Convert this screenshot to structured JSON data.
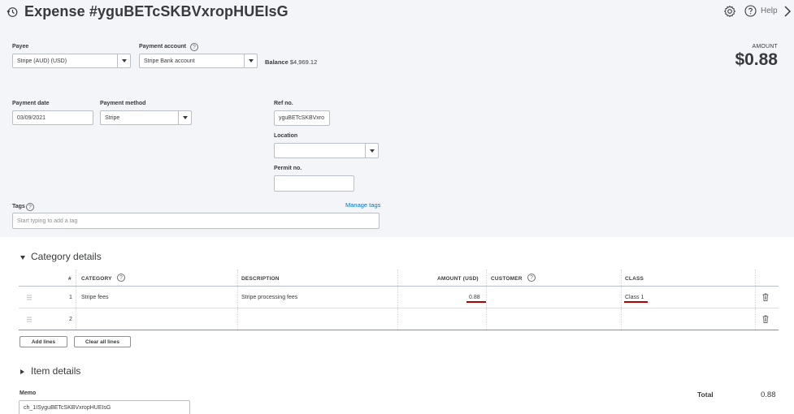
{
  "header": {
    "title": "Expense #yguBETcSKBVxropHUEIsG",
    "help_label": "Help",
    "icons": [
      "history-icon",
      "gear-icon",
      "help-icon",
      "chevron-right-icon"
    ]
  },
  "form": {
    "payee": {
      "label": "Payee",
      "value": "Stripe (AUD) (USD)"
    },
    "payment_account": {
      "label": "Payment account",
      "value": "Stripe Bank account"
    },
    "balance": {
      "label": "Balance",
      "value": "$4,969.12"
    },
    "amount": {
      "label": "AMOUNT",
      "value": "$0.88"
    },
    "payment_date": {
      "label": "Payment date",
      "value": "03/09/2021"
    },
    "payment_method": {
      "label": "Payment method",
      "value": "Stripe"
    },
    "ref_no": {
      "label": "Ref no.",
      "value": "yguBETcSKBVxro"
    },
    "location": {
      "label": "Location",
      "value": ""
    },
    "permit_no": {
      "label": "Permit no.",
      "value": ""
    },
    "tags": {
      "label": "Tags",
      "placeholder": "Start typing to add a tag",
      "manage_link": "Manage tags"
    }
  },
  "category_details": {
    "title": "Category details",
    "columns": {
      "num": "#",
      "category": "CATEGORY",
      "description": "DESCRIPTION",
      "amount": "AMOUNT (USD)",
      "customer": "CUSTOMER",
      "class": "CLASS"
    },
    "rows": [
      {
        "num": "1",
        "category": "Stripe fees",
        "description": "Stripe processing fees",
        "amount": "0.88",
        "customer": "",
        "class": "Class 1"
      },
      {
        "num": "2",
        "category": "",
        "description": "",
        "amount": "",
        "customer": "",
        "class": ""
      }
    ],
    "add_lines_label": "Add lines",
    "clear_all_lines_label": "Clear all lines"
  },
  "item_details": {
    "title": "Item details"
  },
  "memo": {
    "label": "Memo",
    "value": "ch_1ISyguBETcSKBVxropHUEIsG"
  },
  "total": {
    "label": "Total",
    "value": "0.88"
  },
  "colors": {
    "link": "#0077c5",
    "annotation_underline": "#b00000",
    "top_panel_bg": "#f4f5f8"
  }
}
